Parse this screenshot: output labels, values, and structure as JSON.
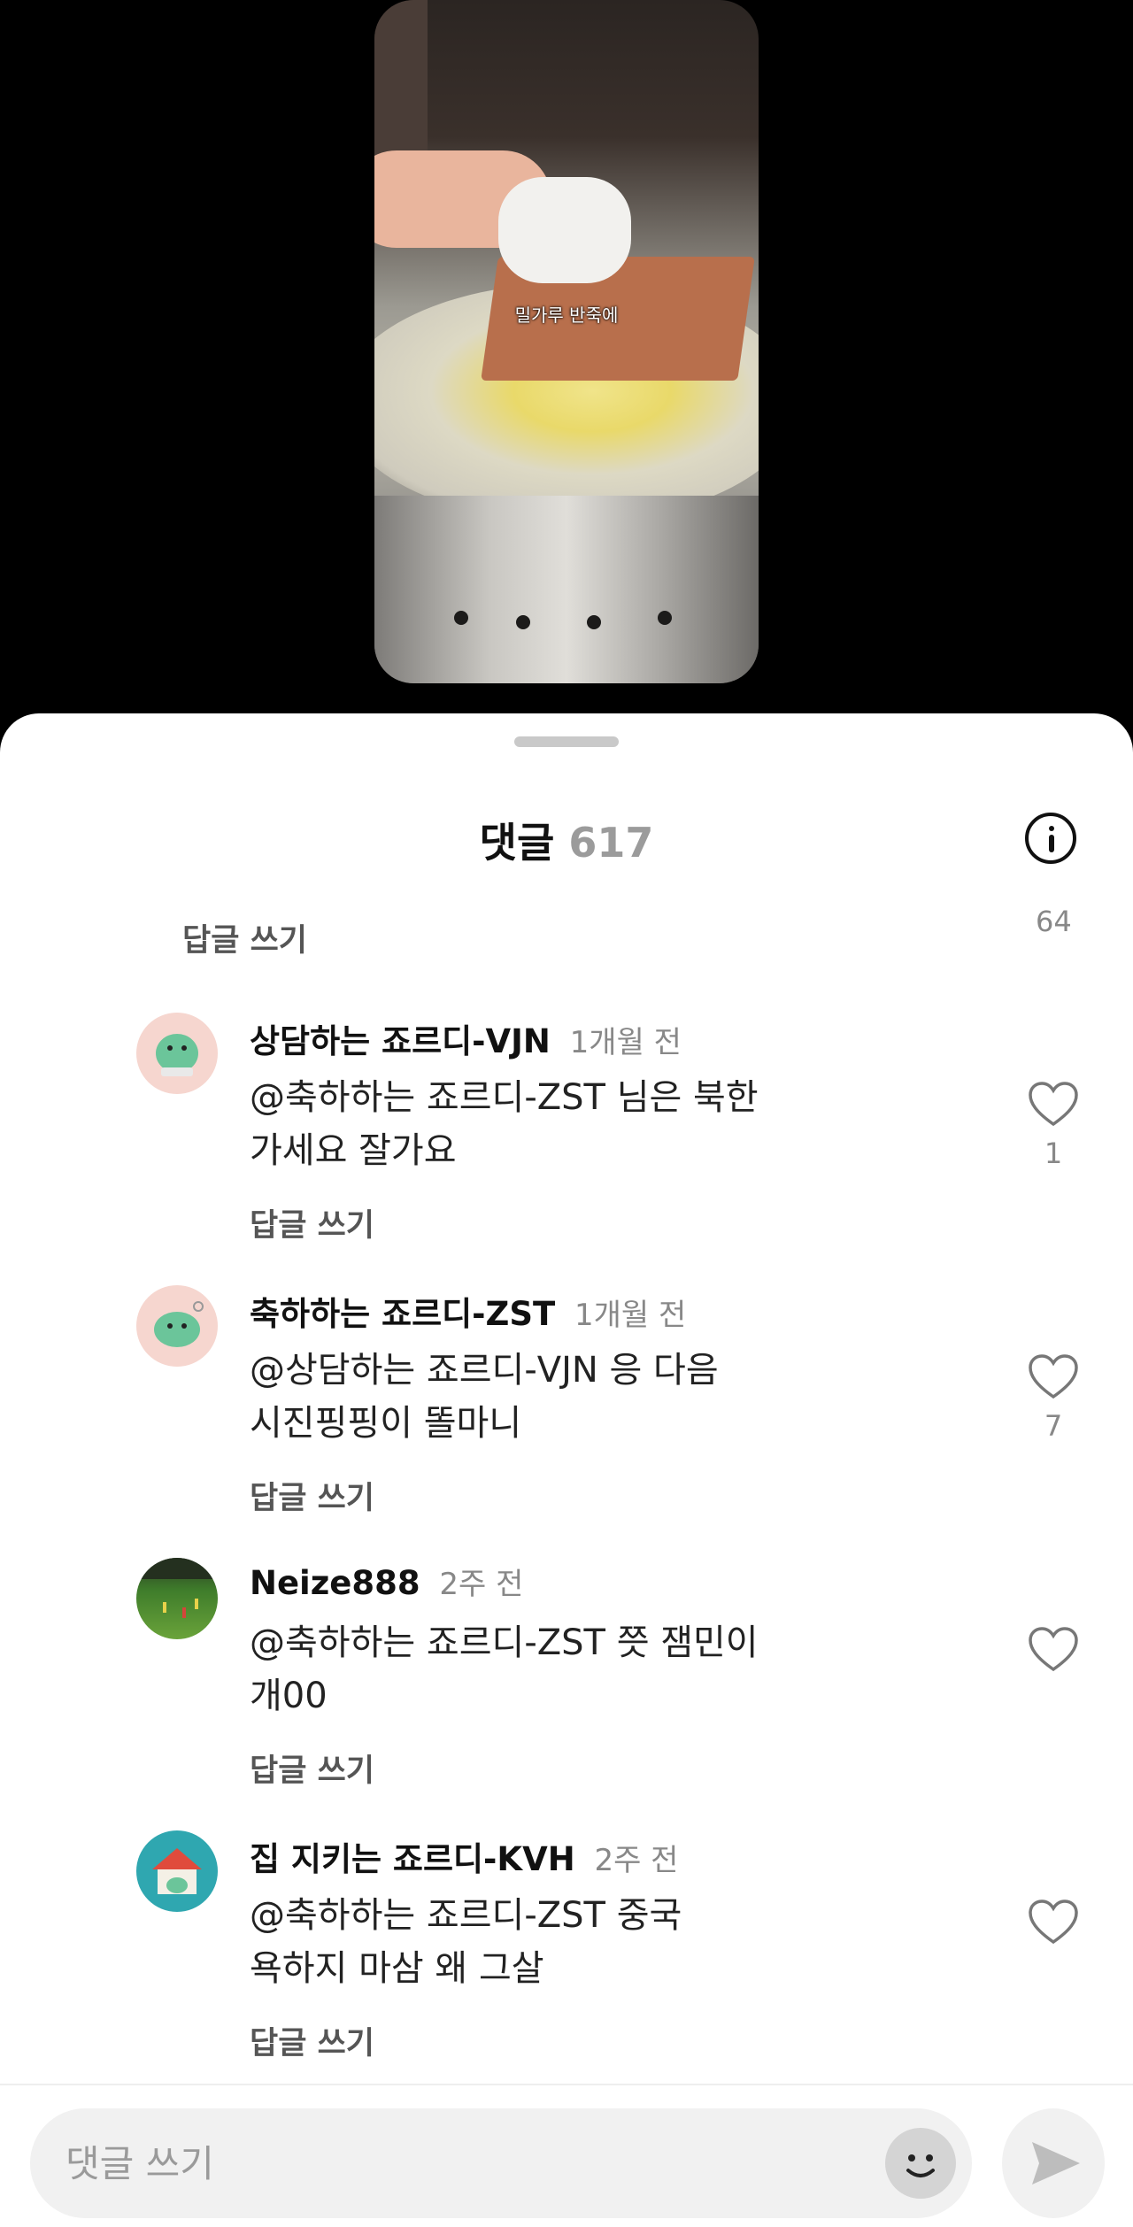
{
  "video": {
    "caption": "밀가루 반죽에"
  },
  "sheet": {
    "title": "댓글",
    "count": "617",
    "top_reply_label": "답글 쓰기",
    "top_like_count": "64"
  },
  "comments": [
    {
      "author": "상담하는 죠르디-VJN",
      "time": "1개월 전",
      "text_line1": "@축하하는 죠르디-ZST 님은 북한",
      "text_line2": "가세요 잘가요",
      "reply_label": "답글 쓰기",
      "likes": "1",
      "avatar_icon": "jordy-pink-avatar-icon"
    },
    {
      "author": "축하하는 죠르디-ZST",
      "time": "1개월 전",
      "text_line1": "@상담하는 죠르디-VJN 응 다음",
      "text_line2": "시진핑핑이 똘마니",
      "reply_label": "답글 쓰기",
      "likes": "7",
      "avatar_icon": "jordy-pink-avatar-icon"
    },
    {
      "author": "Neize888",
      "time": "2주 전",
      "text_line1": "@축하하는 죠르디-ZST 쯧 잼민이",
      "text_line2": "개00",
      "reply_label": "답글 쓰기",
      "likes": "",
      "avatar_icon": "soccer-field-avatar-icon"
    },
    {
      "author": "집 지키는 죠르디-KVH",
      "time": "2주 전",
      "text_line1": "@축하하는 죠르디-ZST 중국",
      "text_line2": "욕하지 마삼 왜 그살",
      "reply_label": "답글 쓰기",
      "likes": "",
      "avatar_icon": "jordy-house-avatar-icon"
    }
  ],
  "composer": {
    "placeholder": "댓글 쓰기",
    "emoji_icon": "smiley-icon",
    "send_icon": "send-icon"
  },
  "colors": {
    "text_primary": "#111111",
    "text_secondary": "#888888",
    "sheet_bg": "#ffffff",
    "video_bg": "#000000"
  }
}
